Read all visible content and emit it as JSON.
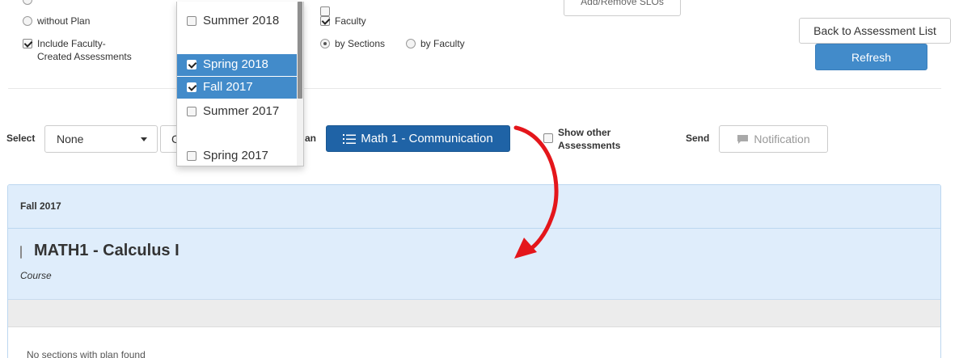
{
  "filters": {
    "without_plan_label": "without Plan",
    "include_faculty_label": "Include Faculty-\nCreated Assessments",
    "faculty_label": "Faculty",
    "by_sections_label": "by Sections",
    "by_faculty_label": "by Faculty"
  },
  "semester_dropdown": {
    "items": [
      {
        "label": "Summer 2018",
        "checked": false,
        "selected": false
      },
      {
        "label": "Spring 2018",
        "checked": true,
        "selected": true
      },
      {
        "label": "Fall 2017",
        "checked": true,
        "selected": true
      },
      {
        "label": "Summer 2017",
        "checked": false,
        "selected": false
      },
      {
        "label": "Spring 2017",
        "checked": false,
        "selected": false
      }
    ]
  },
  "slo_button_label": "Add/Remove SLOs",
  "back_button_label": "Back to Assessment List",
  "refresh_button_label": "Refresh",
  "toolbar": {
    "select_label": "Select",
    "select_value": "None",
    "second_select_value": "C",
    "plan_label_fragment": "an",
    "plan_button_label": "Math 1 - Communication",
    "show_other_label": "Show other\nAssessments",
    "send_label": "Send",
    "notification_label": "Notification"
  },
  "panel": {
    "term": "Fall 2017",
    "course_title": "MATH1 - Calculus I",
    "course_type": "Course",
    "empty_message": "No sections with plan found"
  },
  "colors": {
    "primary": "#428bca",
    "primary_dark": "#1f63a6",
    "panel_bg": "#dfedfb",
    "annotation_arrow": "#e4161b"
  },
  "icons": {
    "plan_icon": "list-numbered-icon",
    "notification_icon": "comment-icon",
    "caret": "caret-down-icon"
  }
}
